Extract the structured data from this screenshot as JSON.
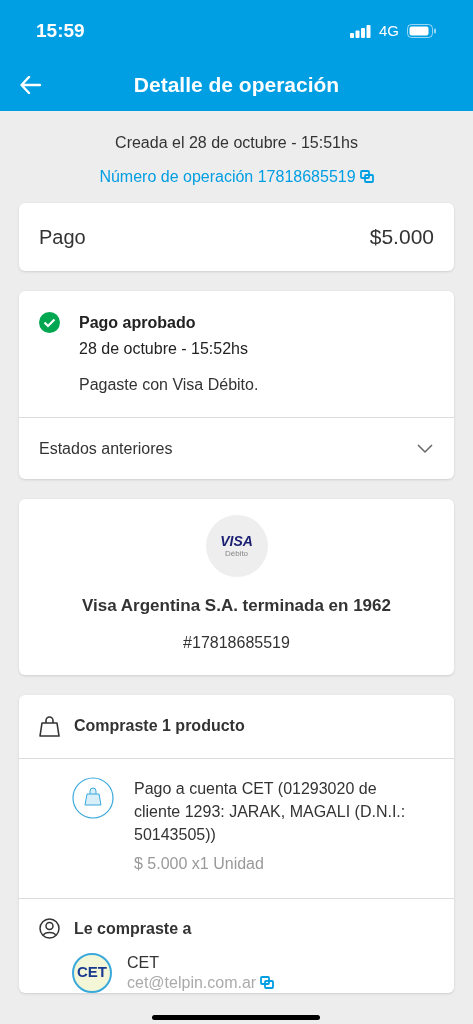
{
  "status_bar": {
    "time": "15:59",
    "network": "4G"
  },
  "header": {
    "title": "Detalle de operación"
  },
  "created": "Creada el 28 de octubre - 15:51hs",
  "operation_number": "Número de operación 17818685519",
  "summary": {
    "label": "Pago",
    "amount": "$5.000"
  },
  "status": {
    "title": "Pago aprobado",
    "date": "28 de octubre - 15:52hs",
    "detail": "Pagaste con Visa Débito.",
    "history_label": "Estados anteriores",
    "expanded": false
  },
  "card": {
    "brand": "VISA",
    "type": "Débito",
    "name": "Visa Argentina S.A. terminada en 1962",
    "number": "#17818685519"
  },
  "purchase": {
    "title": "Compraste 1 producto",
    "description": "Pago a cuenta CET (01293020 de cliente 1293: JARAK, MAGALI (D.N.I.: 50143505))",
    "price": "$ 5.000 x1 Unidad"
  },
  "seller": {
    "title": "Le compraste a",
    "logo_text": "CET",
    "name": "CET",
    "email": "cet@telpin.com.ar"
  }
}
